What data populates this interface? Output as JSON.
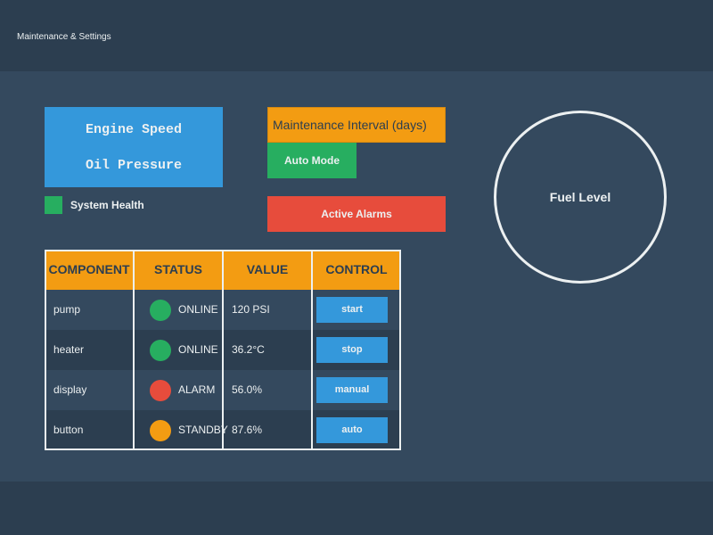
{
  "header": {
    "title": "Maintenance & Settings"
  },
  "engine_panel": {
    "line1": "Engine Speed",
    "line2": "Oil Pressure"
  },
  "system_health": {
    "label": "System Health",
    "color": "#27ae60"
  },
  "controls": {
    "maintenance_interval": "Maintenance Interval (days)",
    "auto_mode": "Auto Mode",
    "active_alarms": "Active Alarms"
  },
  "fuel": {
    "label": "Fuel Level"
  },
  "table": {
    "headers": [
      "COMPONENT",
      "STATUS",
      "VALUE",
      "CONTROL"
    ],
    "rows": [
      {
        "component": "pump",
        "status": "ONLINE",
        "status_color": "#27ae60",
        "value": "120 PSI",
        "control": "start"
      },
      {
        "component": "heater",
        "status": "ONLINE",
        "status_color": "#27ae60",
        "value": "36.2°C",
        "control": "stop"
      },
      {
        "component": "display",
        "status": "ALARM",
        "status_color": "#e74c3c",
        "value": "56.0%",
        "control": "manual"
      },
      {
        "component": "button",
        "status": "STANDBY",
        "status_color": "#f39c12",
        "value": "87.6%",
        "control": "auto"
      }
    ]
  },
  "colors": {
    "background": "#34495e",
    "header": "#2c3e50",
    "accent_blue": "#3498db",
    "accent_orange": "#f39c12",
    "accent_green": "#27ae60",
    "accent_red": "#e74c3c",
    "text": "#ecf0f1"
  }
}
